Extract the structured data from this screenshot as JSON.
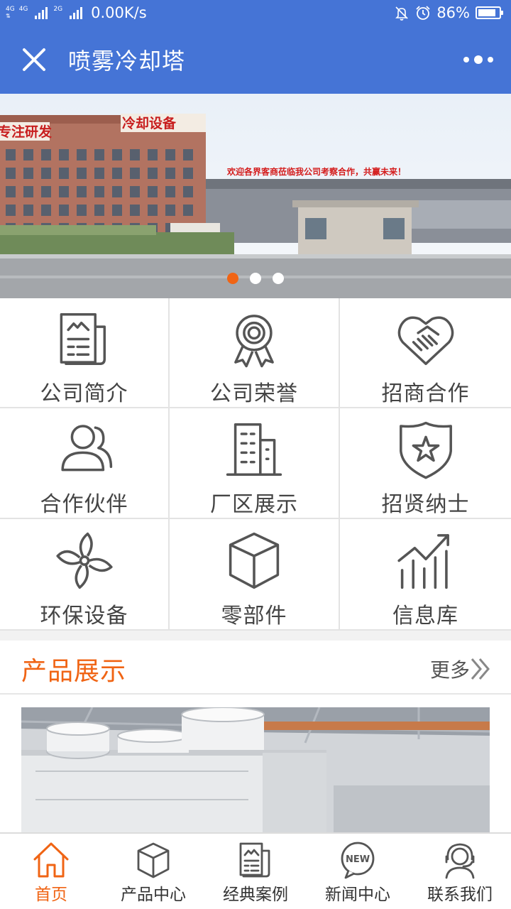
{
  "status_bar": {
    "network_left": "4G",
    "network_left2": "4G",
    "network_right": "2G",
    "speed": "0.00K/s",
    "battery_text": "86%",
    "battery_level": 0.86,
    "icons": [
      "signal-icon",
      "mute-icon",
      "alarm-icon",
      "battery-icon"
    ]
  },
  "header": {
    "title": "喷雾冷却塔",
    "close_icon": "close-icon",
    "more_icon": "more-icon"
  },
  "banner": {
    "slogan": "欢迎各界客商莅临我公司考察合作，共赢未来！",
    "sign_left": "专注研发",
    "sign_right": "冷却设备",
    "slide_count": 3,
    "active_slide": 1
  },
  "menu": [
    {
      "label": "公司简介",
      "icon": "document-icon"
    },
    {
      "label": "公司荣誉",
      "icon": "award-icon"
    },
    {
      "label": "招商合作",
      "icon": "handshake-icon"
    },
    {
      "label": "合作伙伴",
      "icon": "people-icon"
    },
    {
      "label": "厂区展示",
      "icon": "building-icon"
    },
    {
      "label": "招贤纳士",
      "icon": "star-shield-icon"
    },
    {
      "label": "环保设备",
      "icon": "fan-icon"
    },
    {
      "label": "零部件",
      "icon": "cube-icon"
    },
    {
      "label": "信息库",
      "icon": "chart-icon"
    }
  ],
  "products": {
    "title": "产品展示",
    "more": "更多"
  },
  "tabbar": [
    {
      "label": "首页",
      "icon": "home-icon",
      "active": true
    },
    {
      "label": "产品中心",
      "icon": "cube-icon"
    },
    {
      "label": "经典案例",
      "icon": "document-icon"
    },
    {
      "label": "新闻中心",
      "icon": "news-icon",
      "badge": "NEW"
    },
    {
      "label": "联系我们",
      "icon": "headset-icon"
    }
  ],
  "colors": {
    "accent": "#f06414",
    "header": "#4574d6",
    "icon_gray": "#555555"
  }
}
